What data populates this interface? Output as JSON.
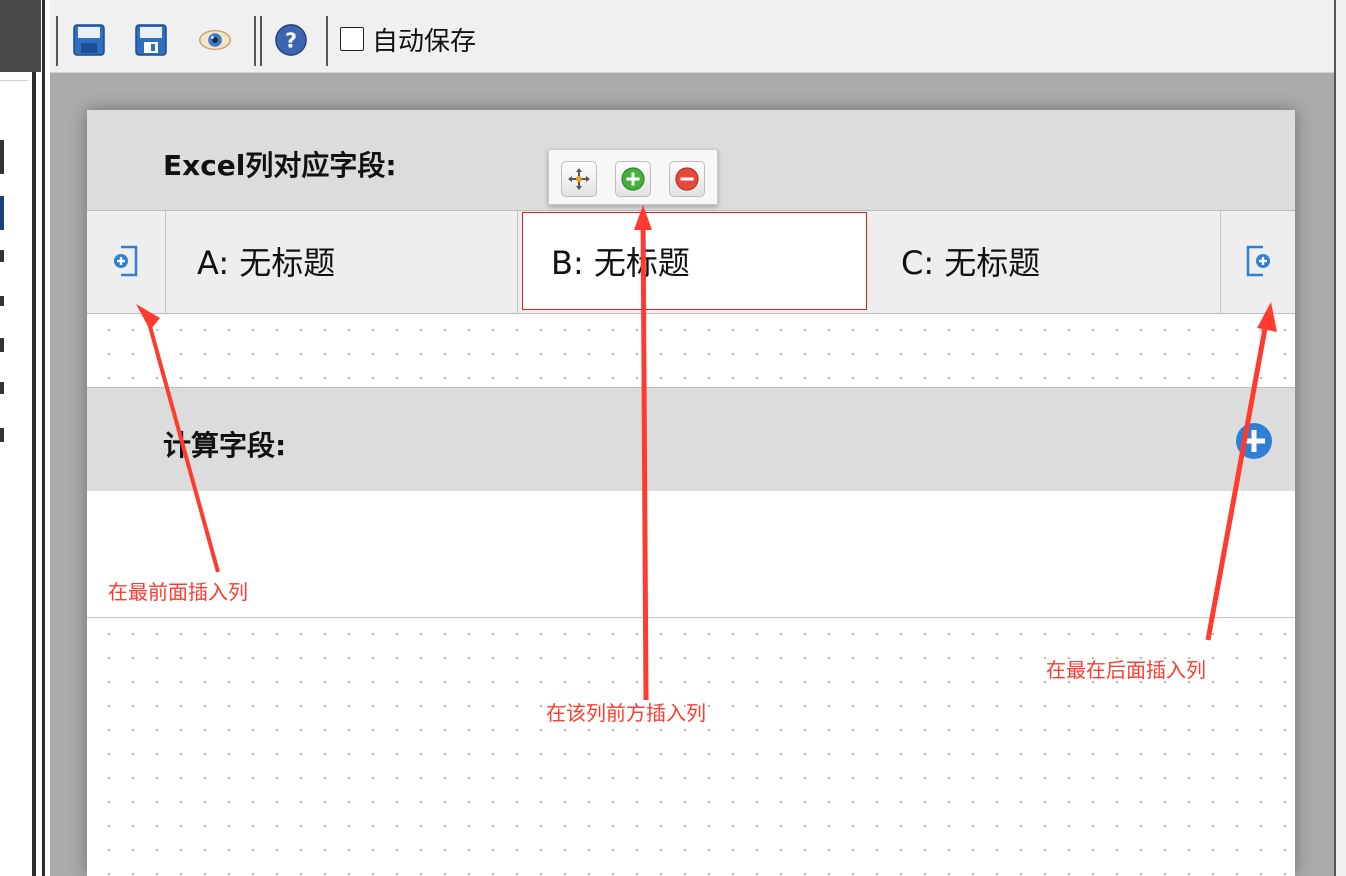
{
  "toolbar": {
    "icons": [
      "save-icon",
      "save-as-icon",
      "preview-eye-icon",
      "help-icon"
    ],
    "autosave_label": "自动保存",
    "autosave_checked": false
  },
  "columns_section": {
    "title": "Excel列对应字段:",
    "insert_front_icon": "insert-column-front-icon",
    "insert_end_icon": "insert-column-end-icon",
    "columns": [
      {
        "label": "A: 无标题",
        "selected": false
      },
      {
        "label": "B: 无标题",
        "selected": true
      },
      {
        "label": "C: 无标题",
        "selected": false
      }
    ],
    "column_toolbar_icons": [
      "move-icon",
      "add-circle-icon",
      "remove-circle-icon"
    ]
  },
  "computed_section": {
    "title": "计算字段:",
    "add_icon": "add-circle-icon"
  },
  "annotations": {
    "insert_front": "在最前面插入列",
    "insert_before_column": "在该列前方插入列",
    "insert_end": "在最在后面插入列"
  },
  "colors": {
    "annotation": "#ff3b30",
    "selection_border": "#e02020",
    "accent_blue": "#2f7fd6"
  }
}
